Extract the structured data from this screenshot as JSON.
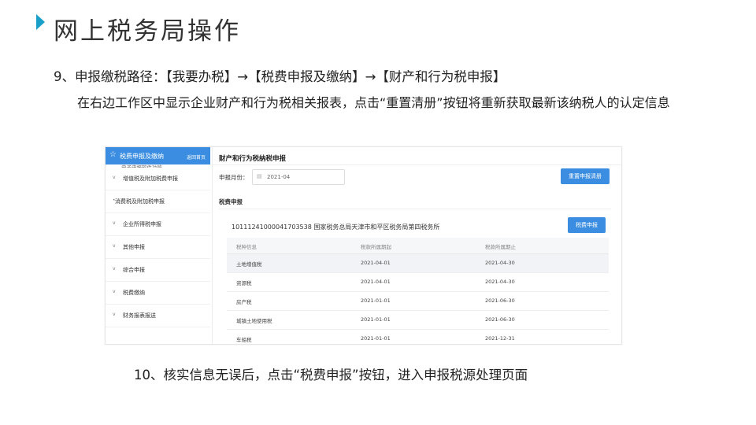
{
  "slide": {
    "title": "网上税务局操作",
    "step9": "9、申报缴税路径：【我要办税】→【税费申报及缴纳】→【财产和行为税申报】",
    "description": "在右边工作区中显示企业财产和行为税相关报表，点击“重置清册”按钮将重新获取最新该纳税人的认定信息",
    "step10": "10、核实信息无误后，点击“税费申报”按钮，进入申报税源处理页面",
    "accent_color": "#1aa0c8"
  },
  "screenshot": {
    "sidebar": {
      "header_title": "税费申报及缴纳",
      "header_link": "返回首页",
      "clipped_item": "电子申报软件功能",
      "items": [
        {
          "label": "增值税及附加税费申报",
          "arrow": "v"
        },
        {
          "label": "消费税及附加税申报",
          "arrow": "•"
        },
        {
          "label": "企业所得税申报",
          "arrow": "v"
        },
        {
          "label": "其他申报",
          "arrow": "v"
        },
        {
          "label": "综合申报",
          "arrow": "v"
        },
        {
          "label": "税费缴纳",
          "arrow": "v"
        },
        {
          "label": "财务报表报送",
          "arrow": "v"
        }
      ]
    },
    "main": {
      "page_title": "财产和行为税纳税申报",
      "month_label": "申报月份：",
      "month_value": "2021-04",
      "reset_button": "重置申报清册",
      "section_label": "税费申报",
      "org_line": "10111241000041703538 国家税务总局天津市和平区税务局第四税务所",
      "declare_button": "税费申报",
      "table": {
        "headers": [
          "税种信息",
          "税款所属期起",
          "税款所属期止"
        ],
        "rows": [
          [
            "土地增值税",
            "2021-04-01",
            "2021-04-30"
          ],
          [
            "资源税",
            "2021-04-01",
            "2021-04-30"
          ],
          [
            "房产税",
            "2021-01-01",
            "2021-06-30"
          ],
          [
            "城镇土地使用税",
            "2021-01-01",
            "2021-06-30"
          ],
          [
            "车船税",
            "2021-01-01",
            "2021-12-31"
          ]
        ]
      },
      "primary_color": "#3a8de0"
    }
  }
}
